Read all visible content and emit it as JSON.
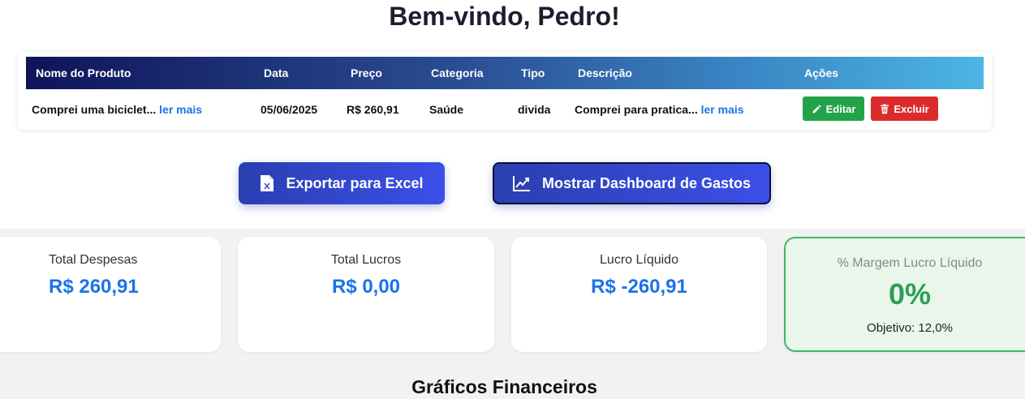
{
  "header": {
    "welcome": "Bem-vindo, Pedro!"
  },
  "table": {
    "columns": [
      "Nome do Produto",
      "Data",
      "Preço",
      "Categoria",
      "Tipo",
      "Descrição",
      "Ações"
    ],
    "rows": [
      {
        "product": "Comprei uma biciclet...",
        "product_more": "ler mais",
        "date": "05/06/2025",
        "price": "R$ 260,91",
        "category": "Saúde",
        "type": "divida",
        "description": "Comprei para pratica...",
        "description_more": "ler mais",
        "edit_label": "Editar",
        "delete_label": "Excluir"
      }
    ]
  },
  "actions": {
    "export_label": "Exportar para Excel",
    "dashboard_label": "Mostrar Dashboard de Gastos"
  },
  "cards": {
    "expenses": {
      "label": "Total Despesas",
      "value": "R$ 260,91"
    },
    "profits": {
      "label": "Total Lucros",
      "value": "R$ 0,00"
    },
    "net": {
      "label": "Lucro Líquido",
      "value": "R$ -260,91"
    },
    "margin": {
      "label": "% Margem Lucro Líquido",
      "value": "0%",
      "goal": "Objetivo: 12,0%"
    }
  },
  "section": {
    "title": "Gráficos Financeiros"
  },
  "colors": {
    "primary_blue": "#1a73e8",
    "edit_green": "#22a34a",
    "delete_red": "#dc2b2b",
    "margin_green": "#2e9e53",
    "button_blue": "#3b4fe8"
  },
  "icons": {
    "edit": "pencil-icon",
    "delete": "trash-icon",
    "export": "excel-file-icon",
    "dashboard": "chart-line-icon"
  }
}
